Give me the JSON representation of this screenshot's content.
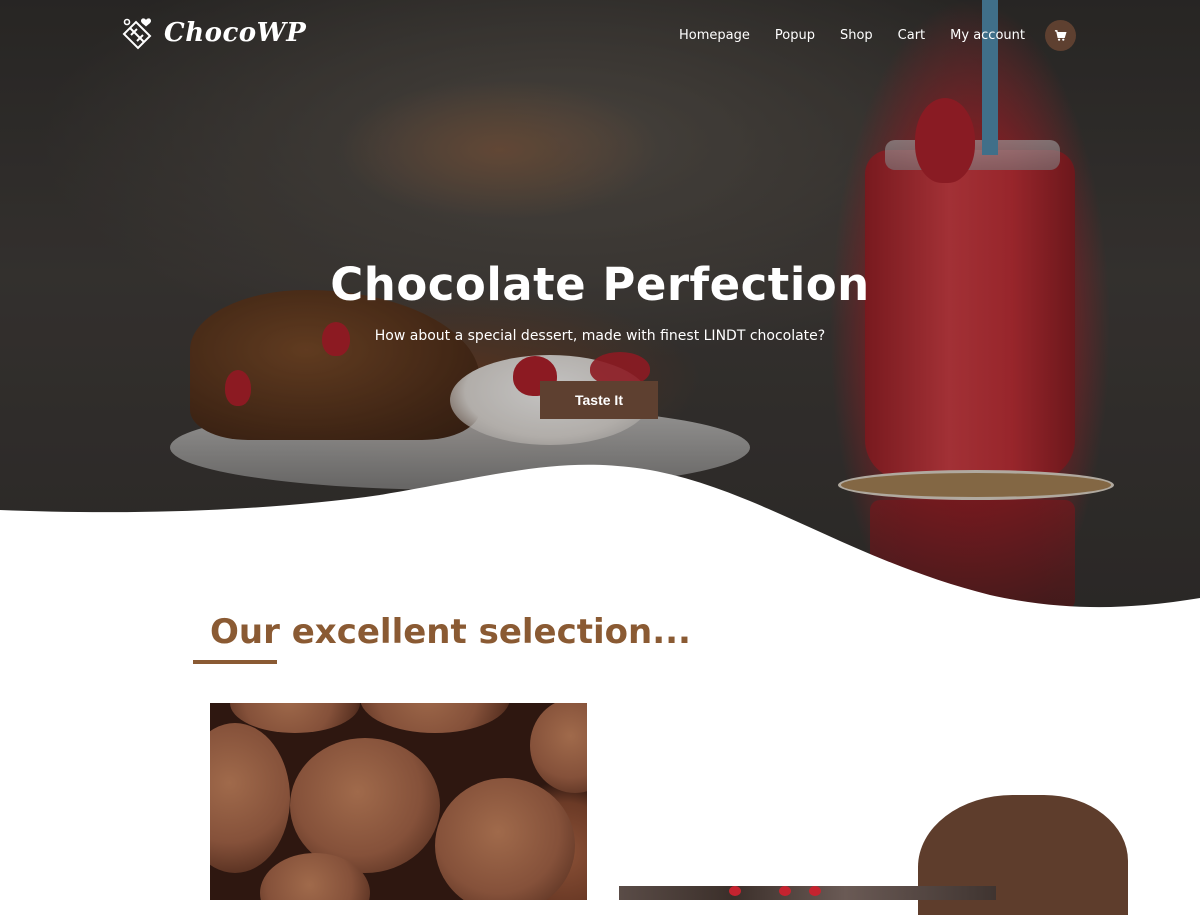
{
  "brand": {
    "name": "ChocoWP",
    "logo_icon": "chocolate-bar-hearts-icon"
  },
  "nav": {
    "items": [
      {
        "label": "Homepage"
      },
      {
        "label": "Popup"
      },
      {
        "label": "Shop"
      },
      {
        "label": "Cart"
      },
      {
        "label": "My account"
      }
    ],
    "cart_icon": "shopping-cart-icon"
  },
  "hero": {
    "title": "Chocolate Perfection",
    "subtitle": "How about a special dessert, made with finest LINDT chocolate?",
    "cta_label": "Taste It"
  },
  "selection": {
    "title": "Our excellent selection..."
  },
  "colors": {
    "accent_brown": "#5e4030",
    "heading_brown": "#8a5a33",
    "white": "#ffffff"
  }
}
